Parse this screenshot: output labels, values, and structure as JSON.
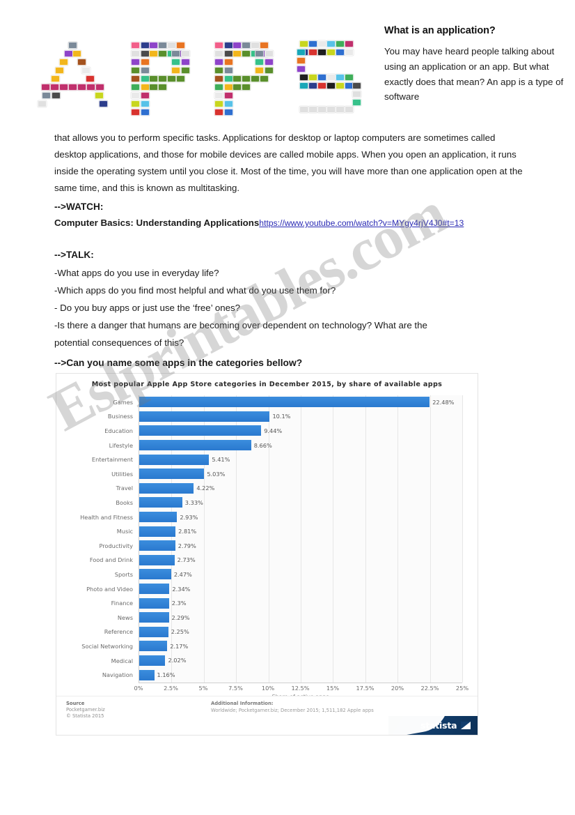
{
  "header": {
    "collage_alt": "APPS letters made of app icons",
    "collage_word": "APPS"
  },
  "intro": {
    "title": "What is an application?",
    "paragraph": "You may have heard people talking about using an application or an app. But what exactly does that mean? An app is a type of software"
  },
  "body": {
    "continuation": "that allows you to perform specific tasks. Applications for desktop or laptop computers are sometimes called desktop applications, and those for mobile devices are called mobile apps. When you open an application, it runs inside the operating system until you close it. Most of the time, you will have more than one application open at the same time, and this is known as multitasking."
  },
  "watch": {
    "lead": "-->WATCH:",
    "title": "Computer Basics: Understanding Applications",
    "url": "https://www.youtube.com/watch?v=MYgy4rjV4J0#t=13"
  },
  "talk": {
    "lead": "-->TALK:",
    "items": [
      "-What apps do you use in everyday life?",
      "-Which apps do you find most helpful and what do you use them for?",
      "- Do you buy apps or just use the ‘free’ ones?",
      "-Is there a danger that humans are becoming over dependent on technology? What are the",
      "potential consequences of this?"
    ]
  },
  "categories_prompt": {
    "heading": "-->Can you name some apps in the categories bellow?"
  },
  "chart_footer": {
    "source_heading": "Source",
    "source_lines": [
      "Pocketgamer.biz",
      "© Statista 2015"
    ],
    "note_heading": "Additional Information:",
    "note_text": "Worldwide; Pocketgamer.biz; December 2015; 1,511,182 Apple apps"
  },
  "statista_logo": {
    "wordmark": "statista"
  },
  "watermark": {
    "text": "Eslprintables.com"
  },
  "chart_data": {
    "type": "bar",
    "orientation": "horizontal",
    "title": "Most popular Apple App Store categories in December 2015, by share of available apps",
    "xlabel": "Share of active apps",
    "ylabel": "",
    "xlim": [
      0,
      25
    ],
    "xticks": [
      "0%",
      "2.5%",
      "5%",
      "7.5%",
      "10%",
      "12.5%",
      "15%",
      "17.5%",
      "20%",
      "22.5%",
      "25%"
    ],
    "xtick_values": [
      0,
      2.5,
      5,
      7.5,
      10,
      12.5,
      15,
      17.5,
      20,
      22.5,
      25
    ],
    "grid": true,
    "legend": "none",
    "bar_color": "#2f7fd4",
    "categories": [
      "Games",
      "Business",
      "Education",
      "Lifestyle",
      "Entertainment",
      "Utilities",
      "Travel",
      "Books",
      "Health and Fitness",
      "Music",
      "Productivity",
      "Food and Drink",
      "Sports",
      "Photo and Video",
      "Finance",
      "News",
      "Reference",
      "Social Networking",
      "Medical",
      "Navigation"
    ],
    "values": [
      22.48,
      10.1,
      9.44,
      8.66,
      5.41,
      5.03,
      4.22,
      3.33,
      2.93,
      2.81,
      2.79,
      2.73,
      2.47,
      2.34,
      2.3,
      2.29,
      2.25,
      2.17,
      2.02,
      1.16
    ],
    "labels": [
      "22.48%",
      "10.1%",
      "9.44%",
      "8.66%",
      "5.41%",
      "5.03%",
      "4.22%",
      "3.33%",
      "2.93%",
      "2.81%",
      "2.79%",
      "2.73%",
      "2.47%",
      "2.34%",
      "2.3%",
      "2.29%",
      "2.25%",
      "2.17%",
      "2.02%",
      "1.16%"
    ]
  }
}
